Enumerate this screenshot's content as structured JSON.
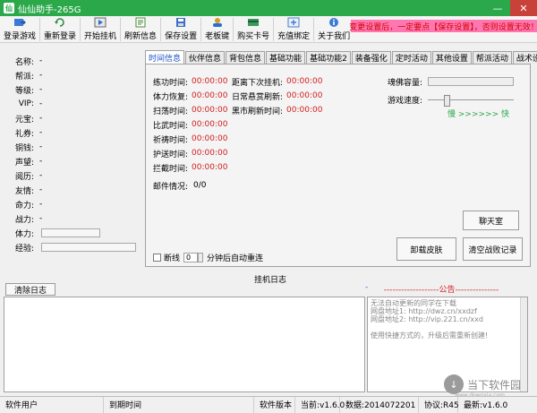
{
  "window": {
    "title": "仙仙助手-265G",
    "app_icon_text": "仙",
    "minimize_glyph": "—",
    "close_glyph": "✕"
  },
  "toolbar": {
    "buttons": [
      {
        "label": "登录游戏",
        "icon": "login-icon"
      },
      {
        "label": "重新登录",
        "icon": "relogin-icon"
      },
      {
        "label": "开始挂机",
        "icon": "play-icon"
      },
      {
        "label": "刷新信息",
        "icon": "refresh-icon"
      },
      {
        "label": "保存设置",
        "icon": "save-icon"
      },
      {
        "label": "老板键",
        "icon": "boss-key-icon"
      },
      {
        "label": "购买卡号",
        "icon": "buy-card-icon"
      },
      {
        "label": "充值绑定",
        "icon": "recharge-icon"
      },
      {
        "label": "关于我们",
        "icon": "about-icon"
      }
    ],
    "notice": "变更设置后，一定要点【保存设置】，否则设置无效！"
  },
  "stats": [
    {
      "label": "名称:",
      "value": "-"
    },
    {
      "label": "帮派:",
      "value": "-"
    },
    {
      "label": "等级:",
      "value": "-"
    },
    {
      "label": "VIP:",
      "value": "-"
    },
    {
      "label": "元宝:",
      "value": "-"
    },
    {
      "label": "礼券:",
      "value": "-"
    },
    {
      "label": "铜钱:",
      "value": "-"
    },
    {
      "label": "声望:",
      "value": "-"
    },
    {
      "label": "阅历:",
      "value": "-"
    },
    {
      "label": "友情:",
      "value": "-"
    },
    {
      "label": "命力:",
      "value": "-"
    },
    {
      "label": "战力:",
      "value": "-"
    },
    {
      "label": "体力:",
      "value": ""
    },
    {
      "label": "经验:",
      "value": ""
    }
  ],
  "tabs": [
    "时间信息",
    "伙伴信息",
    "背包信息",
    "基础功能",
    "基础功能2",
    "装备强化",
    "定时活动",
    "其他设置",
    "帮派活动",
    "战术设置"
  ],
  "time_info": {
    "left": [
      {
        "label": "练功时间:",
        "value": "00:00:00"
      },
      {
        "label": "体力恢复:",
        "value": "00:00:00"
      },
      {
        "label": "扫荡时间:",
        "value": "00:00:00"
      },
      {
        "label": "比武时间:",
        "value": "00:00:00"
      },
      {
        "label": "祈祷时间:",
        "value": "00:00:00"
      },
      {
        "label": "护送时间:",
        "value": "00:00:00"
      },
      {
        "label": "拦截时间:",
        "value": "00:00:00"
      }
    ],
    "middle": [
      {
        "label": "距离下次挂机:",
        "value": "00:00:00"
      },
      {
        "label": "日常悬赏刷新:",
        "value": "00:00:00"
      },
      {
        "label": "黑市刷新时间:",
        "value": "00:00:00"
      }
    ],
    "mail_label": "邮件情况:",
    "mail_value": "0/0",
    "capacity_label": "魂佛容量:",
    "speed_label": "游戏速度:",
    "speed_slow": "慢",
    "speed_arrows": ">>>>>>",
    "speed_fast": "快",
    "speed_level": 0.2,
    "chat_button": "聊天室",
    "unload_button": "卸载皮肤",
    "clear_record_button": "清空战败记录",
    "disconnect_label": "断线",
    "reconnect_minutes": "0",
    "reconnect_suffix": "分钟后自动重连",
    "disconnect_checked": false
  },
  "log": {
    "heading": "挂机日志",
    "clear_button": "清除日志",
    "entries": []
  },
  "announcement": {
    "minus": "-",
    "heading": "-------------------公告---------------",
    "lines": [
      "无法自动更新的同学在下载",
      "网盘地址1: http://dwz.cn/xxdzf",
      "网盘地址2: http://vip.221.cn/xxd",
      "",
      "使用快捷方式的，升级后需重新创建!"
    ]
  },
  "status_bar": {
    "user_type": "软件用户",
    "expire": "到期时间",
    "version_label": "软件版本",
    "current": "当前:v1.6.0",
    "data": "数据:2014072201",
    "protocol": "协议:R45",
    "latest": "最新:v1.6.0"
  },
  "watermark": {
    "text": "当下软件园",
    "sub": "www.downxia.com",
    "glyph": "↓"
  },
  "colors": {
    "title_bar": "#2aa84a",
    "notice_bg": "#ff77b0",
    "value_red": "#d02020",
    "active_tab": "#1a52c9"
  }
}
